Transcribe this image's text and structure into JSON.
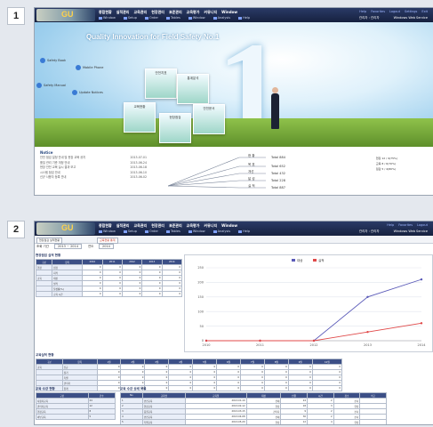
{
  "panels": [
    {
      "number": "1"
    },
    {
      "number": "2"
    }
  ],
  "app": {
    "logo_text": "GU",
    "menu": [
      "종합현황",
      "실적관리",
      "교육관리",
      "현장관리",
      "표준관리",
      "교육평가",
      "커뮤니티",
      "Window"
    ],
    "toolbar": [
      "Window",
      "Setup",
      "Order",
      "Tables",
      "Window",
      "Analysis",
      "Help"
    ],
    "right_links": [
      "Help",
      "Favorites",
      "Logout",
      "Settings",
      "Exit"
    ],
    "right_info": [
      "관리자 : 관리자",
      "Windows Web Service"
    ]
  },
  "home": {
    "tagline": "Quality Innovation for Field Safety No.1",
    "big_number": "1",
    "quick_links": [
      "Safety Book",
      "Mobile Phone",
      "Safety Manual",
      "Update Notices"
    ],
    "tiles": [
      "안전지표",
      "통계분석",
      "교육현황",
      "현장점검",
      "안전문서"
    ],
    "notice_title": "Notice",
    "notices": [
      {
        "text": "안전 점검 일정 안내 및 현장 교육 공지",
        "date": "2013-07-01"
      },
      {
        "text": "품질 관리 기준 개정 안내",
        "date": "2013-06-24"
      },
      {
        "text": "현장 안전 교육 실시 결과 보고",
        "date": "2013-06-18"
      },
      {
        "text": "시스템 점검 안내",
        "date": "2013-06-10"
      },
      {
        "text": "신규 사용자 등록 안내",
        "date": "2013-06-02"
      }
    ],
    "diagram_labels": [
      "현 황",
      "목 표",
      "개선",
      "달 성",
      "실 적"
    ],
    "diagram_values": [
      "Total 884",
      "Total 652",
      "Total 432",
      "Total 228",
      "Total 887"
    ],
    "mini_legend": [
      "현장",
      "교육",
      "점검"
    ],
    "mini_values": [
      "12 / 9(75%)",
      "8 / 6(70%)",
      "5 / 4(80%)"
    ]
  },
  "dashboard": {
    "tabs": [
      "현장점검 실적현황",
      "교육현황 통계",
      "월별 분석"
    ],
    "filter_label": "조회 기간",
    "filter_value": "2013 ~ 2014",
    "year_label": "연도",
    "year_value": "2014",
    "section1": "현장점검 실적 현황",
    "section2": "교육실적 현황",
    "section3": "교육 수강 현황",
    "section4": "교육 수강 상세 목록",
    "table_header": [
      "구분",
      "항목",
      "2010",
      "2011",
      "2012",
      "2013",
      "2014"
    ],
    "table_rows": [
      [
        "현장",
        "점검",
        "0",
        "0",
        "0",
        "0",
        "0"
      ],
      [
        "",
        "지적",
        "0",
        "0",
        "0",
        "0",
        "0"
      ],
      [
        "교육",
        "대상",
        "0",
        "0",
        "0",
        "0",
        "0"
      ],
      [
        "",
        "실적",
        "0",
        "0",
        "0",
        "0",
        "0"
      ],
      [
        "",
        "달성률(%)",
        "0",
        "0",
        "0",
        "0",
        "0"
      ],
      [
        "",
        "교육 시간",
        "0",
        "0",
        "0",
        "0",
        "0"
      ]
    ],
    "table2_header": [
      "구분",
      "항목",
      "1월",
      "2월",
      "3월",
      "4월",
      "5월",
      "6월",
      "7월",
      "8월",
      "9월",
      "10월"
    ],
    "table2_rows": [
      [
        "교육",
        "신규",
        "0",
        "0",
        "0",
        "0",
        "0",
        "0",
        "0",
        "0",
        "0",
        "0"
      ],
      [
        "",
        "정기",
        "0",
        "0",
        "0",
        "0",
        "0",
        "0",
        "0",
        "0",
        "0",
        "0"
      ],
      [
        "",
        "특별",
        "0",
        "0",
        "0",
        "0",
        "0",
        "0",
        "0",
        "0",
        "0",
        "0"
      ],
      [
        "",
        "관리자",
        "0",
        "0",
        "0",
        "0",
        "0",
        "0",
        "0",
        "0",
        "0",
        "0"
      ],
      [
        "",
        "합계",
        "0",
        "0",
        "0",
        "0",
        "0",
        "0",
        "0",
        "0",
        "0",
        "0"
      ]
    ],
    "left_list_header": [
      "구분",
      "건수"
    ],
    "left_list": [
      [
        "사용자교육",
        "24"
      ],
      [
        "관리자교육",
        "12"
      ],
      [
        "현장교육",
        "8"
      ],
      [
        "외부교육",
        "5"
      ]
    ],
    "detail_header": [
      "No",
      "교육명",
      "교육일",
      "대상",
      "인원",
      "시간",
      "장소",
      "비고"
    ],
    "detail_rows": [
      [
        "1",
        "안전교육",
        "2013-01-10",
        "전체",
        "24",
        "2",
        "본사",
        ""
      ],
      [
        "2",
        "현장교육",
        "2013-02-12",
        "현장",
        "18",
        "3",
        "현장",
        ""
      ],
      [
        "3",
        "품질교육",
        "2013-03-15",
        "관리자",
        "9",
        "2",
        "본사",
        ""
      ],
      [
        "4",
        "안전교육",
        "2013-04-08",
        "전체",
        "30",
        "2",
        "본사",
        ""
      ],
      [
        "5",
        "특별교육",
        "2013-05-20",
        "현장",
        "12",
        "4",
        "현장",
        ""
      ],
      [
        "6",
        "정기교육",
        "2013-06-11",
        "전체",
        "27",
        "2",
        "본사",
        ""
      ],
      [
        "7",
        "현장교육",
        "2013-07-03",
        "현장",
        "15",
        "3",
        "현장",
        ""
      ],
      [
        "8",
        "관리교육",
        "2013-08-19",
        "관리자",
        "7",
        "2",
        "본사",
        ""
      ]
    ]
  },
  "chart_data": {
    "type": "line",
    "title": "",
    "xlabel": "",
    "ylabel": "",
    "categories": [
      "2010",
      "2011",
      "2012",
      "2013",
      "2014"
    ],
    "ylim": [
      0,
      250
    ],
    "yticks": [
      0,
      50,
      100,
      150,
      200,
      250
    ],
    "legend_position": "top-center",
    "grid": true,
    "series": [
      {
        "name": "대상",
        "color": "#5a5ab8",
        "values": [
          0,
          0,
          0,
          150,
          210
        ]
      },
      {
        "name": "실적",
        "color": "#e04848",
        "values": [
          0,
          0,
          0,
          30,
          60
        ]
      }
    ]
  }
}
